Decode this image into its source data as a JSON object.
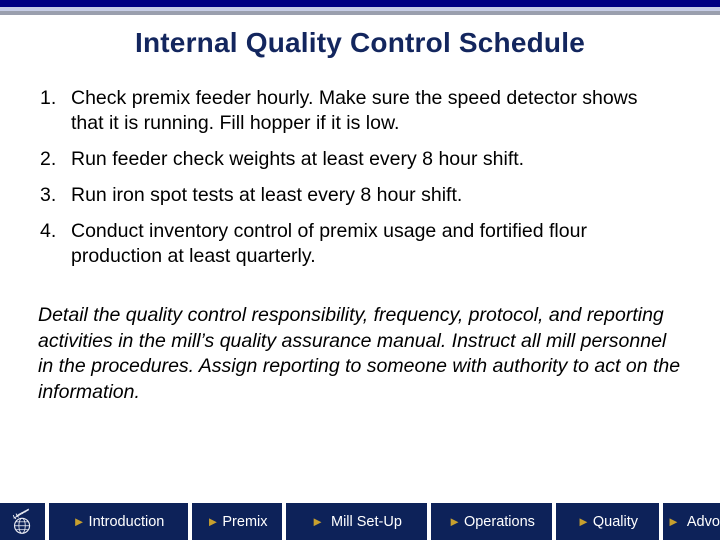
{
  "theme": {
    "navy_bar": "#000082",
    "lavender_bar": "#c6cde6",
    "gray_bar": "#9a9fae",
    "title_color": "#13265e",
    "nav_background": "#0d2259",
    "nav_text": "#ffffff",
    "nav_triangle": "#c8a02e"
  },
  "slide": {
    "title": "Internal Quality Control Schedule",
    "items": [
      "Check premix feeder hourly. Make sure the speed detector shows that it is running. Fill hopper if it is low.",
      "Run feeder check weights at least every 8 hour shift.",
      "Run iron spot tests at least every 8 hour shift.",
      "Conduct inventory control of premix usage and fortified flour production at least quarterly."
    ],
    "detail_paragraph": "Detail the quality control responsibility, frequency, protocol, and reporting activities in the mill’s quality assurance manual. Instruct all mill personnel in the procedures. Assign reporting to someone with authority to act on the information."
  },
  "nav": {
    "logo_icon": "globe-wheat-logo-icon",
    "triangle_glyph": "►",
    "tabs": [
      {
        "label": "Introduction"
      },
      {
        "label": "Premix"
      },
      {
        "label": "Mill Set-Up"
      },
      {
        "label": "Operations"
      },
      {
        "label": "Quality"
      },
      {
        "label": "Advocacy"
      }
    ]
  }
}
